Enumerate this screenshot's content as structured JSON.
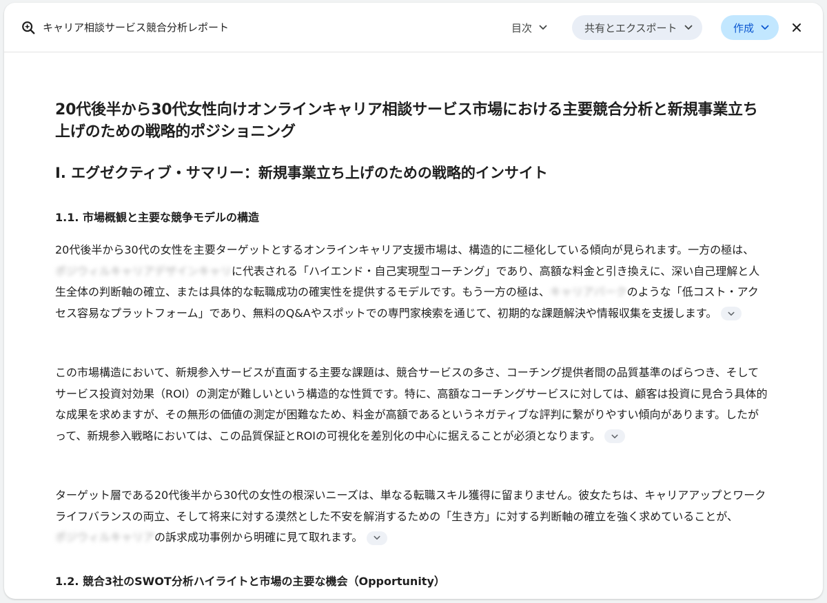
{
  "header": {
    "title": "キャリア相談サービス競合分析レポート",
    "toc_label": "目次",
    "share_label": "共有とエクスポート",
    "create_label": "作成"
  },
  "document": {
    "title": "20代後半から30代女性向けオンラインキャリア相談サービス市場における主要競合分析と新規事業立ち上げのための戦略的ポジショニング",
    "section1_heading": "I. エグゼクティブ・サマリー：新規事業立ち上げのための戦略的インサイト",
    "subsection_1_1": "1.1. 市場概観と主要な競争モデルの構造",
    "p1_a": "20代後半から30代の女性を主要ターゲットとするオンラインキャリア支援市場は、構造的に二極化している傾向が見られます。一方の極は、",
    "p1_redacted_1": "ポジウィルキャリアデザインキャリ",
    "p1_b": "に代表される「ハイエンド・自己実現型コーチング」であり、高額な料金と引き換えに、深い自己理解と人生全体の判断軸の確立、または具体的な転職成功の確実性を提供するモデルです。もう一方の極は、",
    "p1_redacted_2": "キャリアパーク",
    "p1_c": "のような「低コスト・アクセス容易なプラットフォーム」であり、無料のQ&Aやスポットでの専門家検索を通じて、初期的な課題解決や情報収集を支援します。",
    "p2": "この市場構造において、新規参入サービスが直面する主要な課題は、競合サービスの多さ、コーチング提供者間の品質基準のばらつき、そしてサービス投資対効果（ROI）の測定が難しいという構造的な性質です。特に、高額なコーチングサービスに対しては、顧客は投資に見合う具体的な成果を求めますが、その無形の価値の測定が困難なため、料金が高額であるというネガティブな評判に繋がりやすい傾向があります。したがって、新規参入戦略においては、この品質保証とROIの可視化を差別化の中心に据えることが必須となります。",
    "p3_a": "ターゲット層である20代後半から30代の女性の根深いニーズは、単なる転職スキル獲得に留まりません。彼女たちは、キャリアアップとワークライフバランスの両立、そして将来に対する漠然とした不安を解消するための「生き方」に対する判断軸の確立を強く求めていることが、",
    "p3_redacted": "ポジウィルキャリア",
    "p3_b": "の訴求成功事例から明確に見て取れます。",
    "subsection_1_2": "1.2. 競合3社のSWOT分析ハイライトと市場の主要な機会（Opportunity）"
  },
  "icons": {
    "logo": "deep-research-icon",
    "toc_chevron": "chevron-down-icon",
    "share_chevron": "chevron-down-icon",
    "create_chevron": "chevron-down-icon",
    "close": "close-icon",
    "expand": "chevron-down-icon"
  },
  "colors": {
    "create_bg": "#c2e7ff",
    "create_text": "#0b57d0",
    "share_bg": "#e9eef6"
  }
}
